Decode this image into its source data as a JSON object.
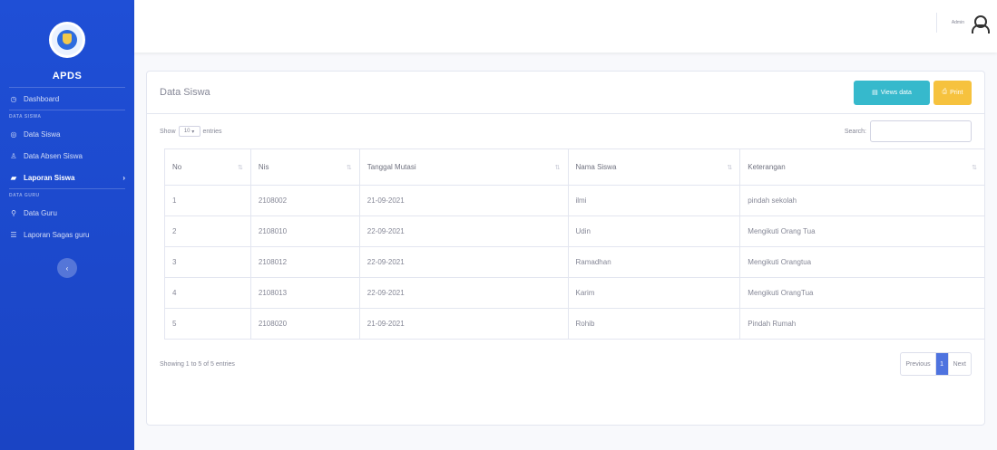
{
  "sidebar": {
    "brand": "APDS",
    "items": [
      {
        "label": "Dashboard",
        "icon": "dashboard-icon",
        "glyph": "◷",
        "heading_before": null
      },
      {
        "label": "Data Siswa",
        "icon": "circle-icon",
        "glyph": "◎",
        "heading_before": "DATA SISWA"
      },
      {
        "label": "Data Absen Siswa",
        "icon": "user-icon",
        "glyph": "♙",
        "heading_before": null
      },
      {
        "label": "Laporan Siswa",
        "icon": "folder-icon",
        "glyph": "▰",
        "heading_before": null,
        "active": true
      },
      {
        "label": "Data Guru",
        "icon": "search-icon",
        "glyph": "⚲",
        "heading_before": "DATA GURU"
      },
      {
        "label": "Laporan Sagas guru",
        "icon": "list-icon",
        "glyph": "☰",
        "heading_before": null
      }
    ],
    "toggle_glyph": "‹"
  },
  "topbar": {
    "user_name": "Admin"
  },
  "card": {
    "title": "Data Siswa",
    "view_button": "Views data",
    "print_button": "Print",
    "show_prefix": "Show",
    "show_value": "10",
    "show_suffix": "entries",
    "search_label": "Search:",
    "columns": [
      "No",
      "Nis",
      "Tanggal Mutasi",
      "Nama Siswa",
      "Keterangan"
    ],
    "rows": [
      [
        "1",
        "2108002",
        "21-09-2021",
        "ilmi",
        "pindah sekolah"
      ],
      [
        "2",
        "2108010",
        "22-09-2021",
        "Udin",
        "Mengikuti Orang Tua"
      ],
      [
        "3",
        "2108012",
        "22-09-2021",
        "Ramadhan",
        "Mengikuti Orangtua"
      ],
      [
        "4",
        "2108013",
        "22-09-2021",
        "Karim",
        "Mengikuti OrangTua"
      ],
      [
        "5",
        "2108020",
        "21-09-2021",
        "Rohib",
        "Pindah Rumah"
      ]
    ],
    "info": "Showing 1 to 5 of 5 entries",
    "pagination": {
      "previous": "Previous",
      "current": "1",
      "next": "Next"
    }
  }
}
